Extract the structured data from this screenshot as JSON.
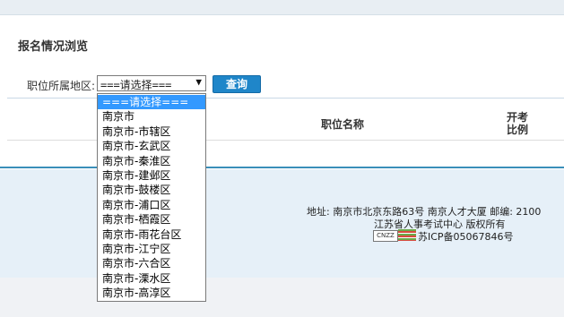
{
  "page": {
    "title": "报名情况浏览"
  },
  "filter": {
    "label": "职位所属地区:",
    "selected": "===请选择===",
    "arrow": "▼",
    "button": "查询",
    "options": [
      "===请选择===",
      "南京市",
      "南京市-市辖区",
      "南京市-玄武区",
      "南京市-秦淮区",
      "南京市-建邺区",
      "南京市-鼓楼区",
      "南京市-浦口区",
      "南京市-栖霞区",
      "南京市-雨花台区",
      "南京市-江宁区",
      "南京市-六合区",
      "南京市-溧水区",
      "南京市-高淳区"
    ],
    "highlighted_index": 0
  },
  "table": {
    "headers": {
      "name": "职位名称",
      "ratio_line1": "开考",
      "ratio_line2": "比例"
    }
  },
  "footer": {
    "address": "地址: 南京市北京东路63号 南京人才大厦 邮编: 2100",
    "sponsor": "江苏省人事考试中心 版权所有",
    "cnzz": "CNZZ",
    "icp": "苏ICP备05067846号"
  },
  "colors": {
    "button_bg": "#1f86c9",
    "highlight": "#3399ff",
    "footer_bg": "#e6f0f8",
    "footer_rule": "#3a8fb9"
  }
}
